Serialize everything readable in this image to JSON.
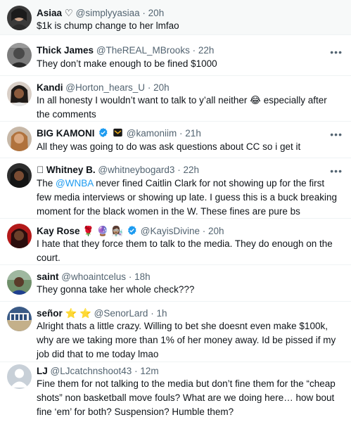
{
  "tweets": [
    {
      "name": "Asiaa ♡",
      "handle": "@simplyyasiaa",
      "time": "20h",
      "text": "$1k is chump change to her lmfao"
    },
    {
      "name": "Thick James",
      "handle": "@TheREAL_MBrooks",
      "time": "22h",
      "text": "They don’t make enough to be fined $1000"
    },
    {
      "name": "Kandi",
      "handle": "@Horton_hears_U",
      "time": "20h",
      "text": "In all honesty I wouldn’t want to talk to y’all neither 😂 especially after the comments"
    },
    {
      "name": "BIG KAMONI",
      "handle": "@kamoniim",
      "time": "21h",
      "text": "All they was going to do was ask questions about CC so i get it"
    },
    {
      "name": " Whitney B.",
      "handle": "@whitneybogard3",
      "time": "22h",
      "text_before": "The ",
      "mention": "@WNBA",
      "text_after": " never fined Caitlin Clark for not showing up for the first few media interviews or showing up late. I guess this is a buck breaking moment for the black women in the W. These fines are pure bs"
    },
    {
      "name": "Kay Rose",
      "name_emoji": "🌹 🔮 👩🏽‍🔬",
      "handle": "@KayisDivine",
      "time": "20h",
      "text": "I hate that they force them to talk to the media. They do enough on the court."
    },
    {
      "name": "saint",
      "handle": "@whoaintcelus",
      "time": "18h",
      "text": "They gonna take her whole check???"
    },
    {
      "name": "señor",
      "name_emoji": "⭐ ⭐",
      "handle": "@SenorLard",
      "time": "1h",
      "text": "Alright thats a little crazy. Willing to bet she doesnt even make $100k, why are we taking more than 1% of her money away. Id be pissed if my job did that to me today lmao"
    },
    {
      "name": "LJ",
      "handle": "@LJcatchnshoot43",
      "time": "12m",
      "text": "Fine them for not talking to the media but don’t fine them for the “cheap shots” non basketball move fouls? What are we doing here… how bout fine ‘em’  for both? Suspension? Humble them?"
    }
  ],
  "more_label": "•••",
  "dot": "·",
  "colors": {
    "verified": "#1d9bf0",
    "gold_badge": "#e8a917",
    "link": "#1d9bf0",
    "secondary_text": "#536471"
  }
}
